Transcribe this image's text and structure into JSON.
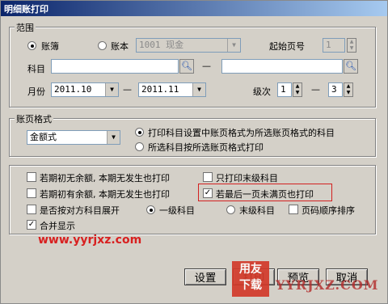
{
  "window": {
    "title": "明细账打印"
  },
  "range": {
    "legend": "范围",
    "opt_ledger": "账簿",
    "opt_account": "账本",
    "account_value": "1001 现金",
    "start_page_label": "起始页号",
    "start_page_value": "1",
    "subject_label": "科目",
    "subject_from": "",
    "subject_to": "",
    "dash": "—",
    "month_label": "月份",
    "month_from": "2011.10",
    "month_to": "2011.11",
    "level_label": "级次",
    "level_from": "1",
    "level_to": "3"
  },
  "format": {
    "legend": "账页格式",
    "selected": "金额式",
    "opt_subject_setting": "打印科目设置中账页格式为所选账页格式的科目",
    "opt_all_subjects": "所选科目按所选账页格式打印"
  },
  "options": {
    "no_balance_no_occur": "若期初无余额, 本期无发生也打印",
    "has_balance_no_occur": "若期初有余额, 本期无发生也打印",
    "expand_by_counter": "是否按对方科目展开",
    "level_one": "一级科目",
    "leaf_level": "末级科目",
    "merge_display": "合并显示",
    "only_leaf": "只打印末级科目",
    "last_page_print": "若最后一页未满页也打印",
    "page_order": "页码顺序排序"
  },
  "buttons": {
    "settings": "设置",
    "print": "打印",
    "preview": "预览",
    "cancel": "取消"
  },
  "watermark": {
    "url": "www.yyrjxz.com",
    "brand_top": "用友",
    "brand_bottom": "下载",
    "site": "YYRJXZ.COM"
  },
  "colors": {
    "titlebar": "#0a246a",
    "highlight_box": "#d32020",
    "watermark": "#d82020"
  }
}
